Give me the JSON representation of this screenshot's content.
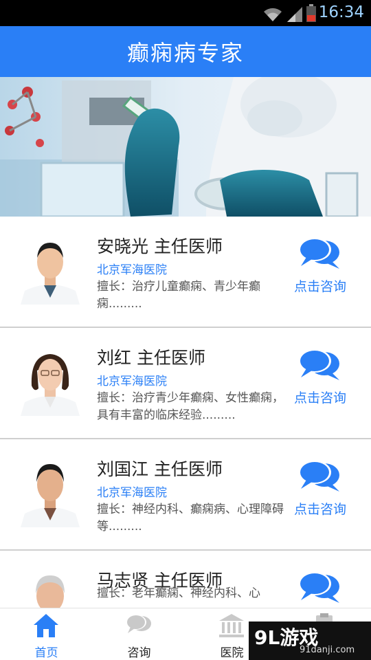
{
  "status_bar": {
    "time": "16:34",
    "icons": [
      "wifi-icon",
      "signal-icon",
      "battery-icon"
    ]
  },
  "app_bar": {
    "title": "癫痫病专家"
  },
  "doctors": [
    {
      "name": "安晓光 主任医师",
      "hospital": "北京军海医院",
      "desc": "擅长：治疗儿童癫痫、青少年癫痫.........",
      "consult_label": "点击咨询"
    },
    {
      "name": "刘红 主任医师",
      "hospital": "北京军海医院",
      "desc": "擅长：治疗青少年癫痫、女性癫痫，具有丰富的临床经验.........",
      "consult_label": "点击咨询"
    },
    {
      "name": "刘国江 主任医师",
      "hospital": "北京军海医院",
      "desc": "擅长：神经内科、癫痫病、心理障碍等.........",
      "consult_label": "点击咨询"
    },
    {
      "name": "马志贤 主任医师",
      "hospital": "",
      "desc": "擅长：老年癫痫、神经内科、心",
      "consult_label": ""
    }
  ],
  "tabs": [
    {
      "label": "首页",
      "icon": "home-icon",
      "active": true
    },
    {
      "label": "咨询",
      "icon": "chat-icon",
      "active": false
    },
    {
      "label": "医院",
      "icon": "hospital-icon",
      "active": false
    },
    {
      "label": "",
      "icon": "clipboard-icon",
      "active": false
    }
  ],
  "watermark": {
    "logo": "9L游戏",
    "url": "91danji.com"
  },
  "colors": {
    "primary": "#2a7ff6",
    "status_bar": "#000000",
    "divider": "#cfcfcf"
  }
}
